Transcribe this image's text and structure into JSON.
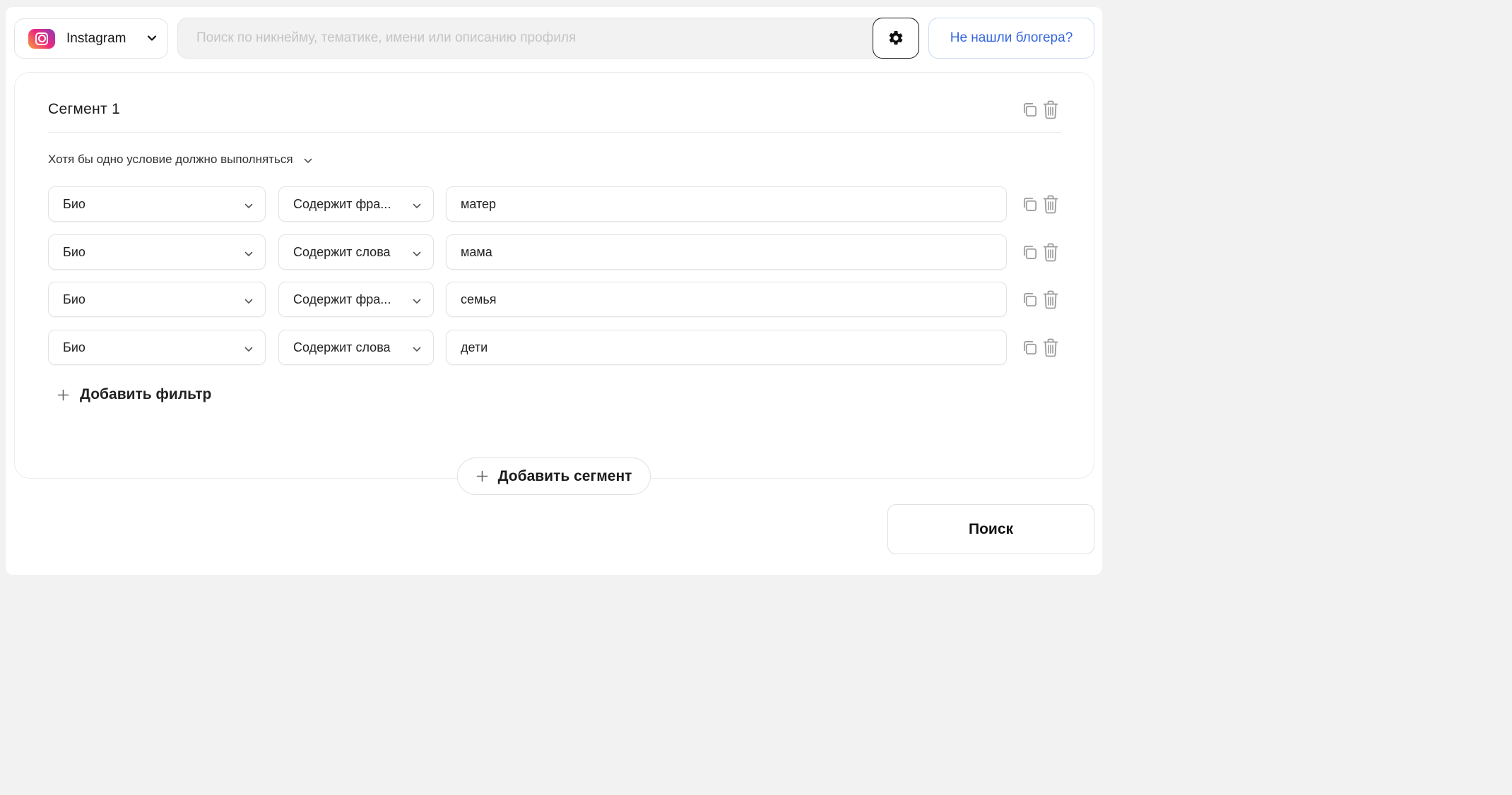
{
  "platform": {
    "label": "Instagram",
    "icon": "instagram-icon"
  },
  "search": {
    "placeholder": "Поиск по никнейму, тематике, имени или описанию профиля",
    "value": ""
  },
  "settings": {
    "icon": "gear-icon"
  },
  "not_found_label": "Не нашли блогера?",
  "segment": {
    "title": "Сегмент 1",
    "condition": "Хотя бы одно условие должно выполняться",
    "filters": [
      {
        "field": "Био",
        "operator": "Содержит фра...",
        "value": "матер"
      },
      {
        "field": "Био",
        "operator": "Содержит слова",
        "value": "мама"
      },
      {
        "field": "Био",
        "operator": "Содержит фра...",
        "value": "семья"
      },
      {
        "field": "Био",
        "operator": "Содержит слова",
        "value": "дети"
      }
    ],
    "add_filter_label": "Добавить фильтр"
  },
  "add_segment_label": "Добавить сегмент",
  "search_button_label": "Поиск",
  "colors": {
    "accent_blue": "#3366e0",
    "border": "#e2e2e2",
    "icon_gray": "#9a9a9a"
  }
}
